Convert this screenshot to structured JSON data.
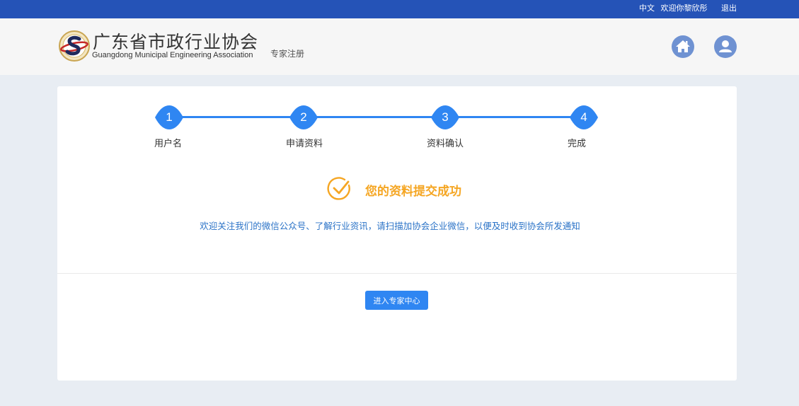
{
  "topbar": {
    "language": "中文",
    "welcome": "欢迎你黎欣彤",
    "logout": "退出"
  },
  "header": {
    "org_name_cn": "广东省市政行业协会",
    "org_name_en": "Guangdong Municipal Engineering Association",
    "page_subtitle": "专家注册",
    "home_icon": "home-icon",
    "user_icon": "user-icon"
  },
  "steps": [
    {
      "number": "1",
      "label": "用户名"
    },
    {
      "number": "2",
      "label": "申请资料"
    },
    {
      "number": "3",
      "label": "资料确认"
    },
    {
      "number": "4",
      "label": "完成"
    }
  ],
  "result": {
    "title": "您的资料提交成功",
    "notice": "欢迎关注我们的微信公众号、了解行业资讯，请扫描加协会企业微信，以便及时收到协会所发通知",
    "icon": "check-circle-icon"
  },
  "actions": {
    "enter_center": "进入专家中心"
  },
  "colors": {
    "topbar": "#2553b7",
    "accent": "#2f86f2",
    "success": "#f5a623",
    "notice_text": "#2b73c7",
    "icon_button": "#6f92d2"
  }
}
